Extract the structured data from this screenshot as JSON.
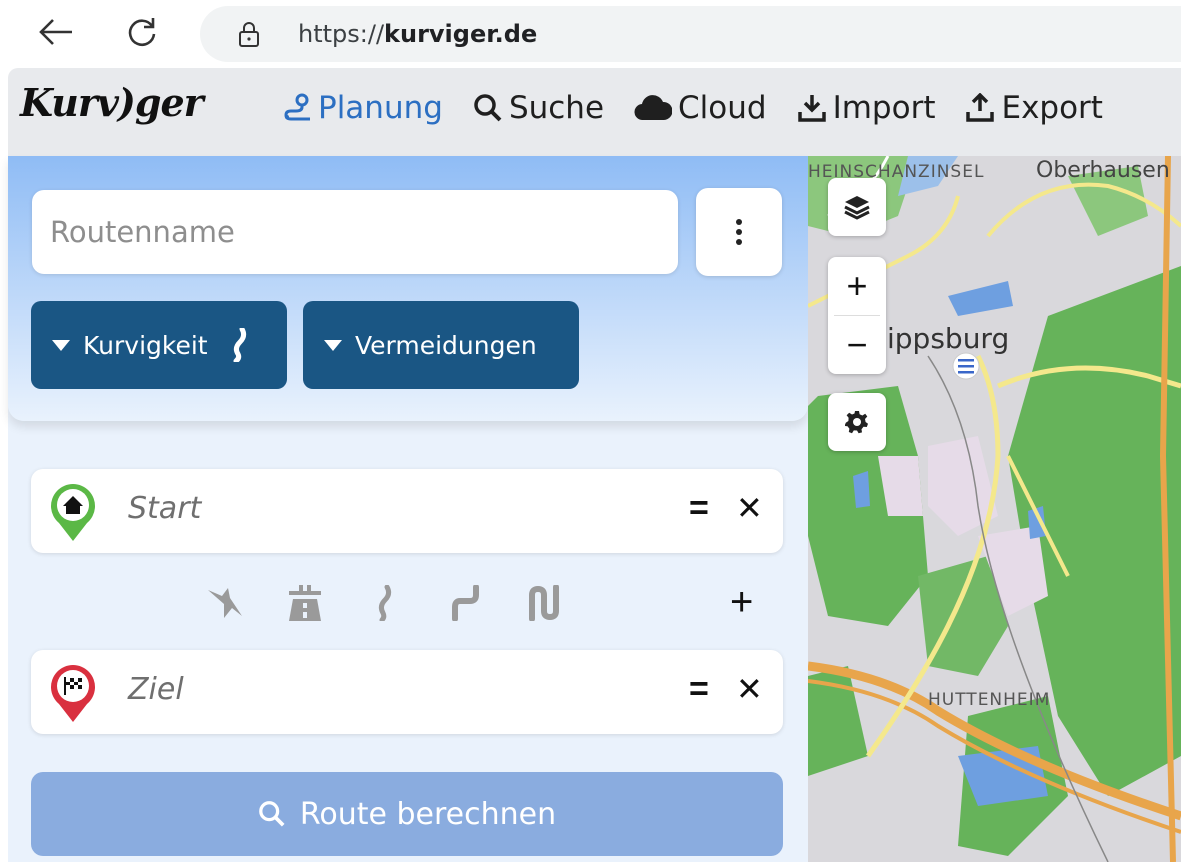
{
  "browser": {
    "url_prefix": "https://",
    "url_domain": "kurviger.de"
  },
  "header": {
    "logo": "Kurv)ger",
    "nav": [
      {
        "label": "Planung",
        "icon": "route-icon",
        "active": true
      },
      {
        "label": "Suche",
        "icon": "search-icon"
      },
      {
        "label": "Cloud",
        "icon": "cloud-icon"
      },
      {
        "label": "Import",
        "icon": "download-icon"
      },
      {
        "label": "Export",
        "icon": "upload-icon"
      }
    ]
  },
  "planner": {
    "routename_placeholder": "Routenname",
    "kurvigkeit_label": "Kurvigkeit",
    "vermeidungen_label": "Vermeidungen",
    "start_label": "Start",
    "ziel_label": "Ziel",
    "drag_symbol": "=",
    "remove_symbol": "✕",
    "add_symbol": "+",
    "calc_label": "Route berechnen"
  },
  "map": {
    "labels": {
      "heinschanzinsel": "HEINSCHANZINSEL",
      "oberhausen": "Oberhausen",
      "philippsburg": "ippsburg",
      "huttenheim": "HUTTENHEIM"
    },
    "zoom_in": "+",
    "zoom_out": "−"
  },
  "colors": {
    "accent": "#2c6fc2",
    "dropdown_bg": "#1a5684",
    "calc_btn_bg": "#8aacdf",
    "start_pin": "#5bb846",
    "ziel_pin": "#d9303f",
    "forest": "#66b35a"
  }
}
